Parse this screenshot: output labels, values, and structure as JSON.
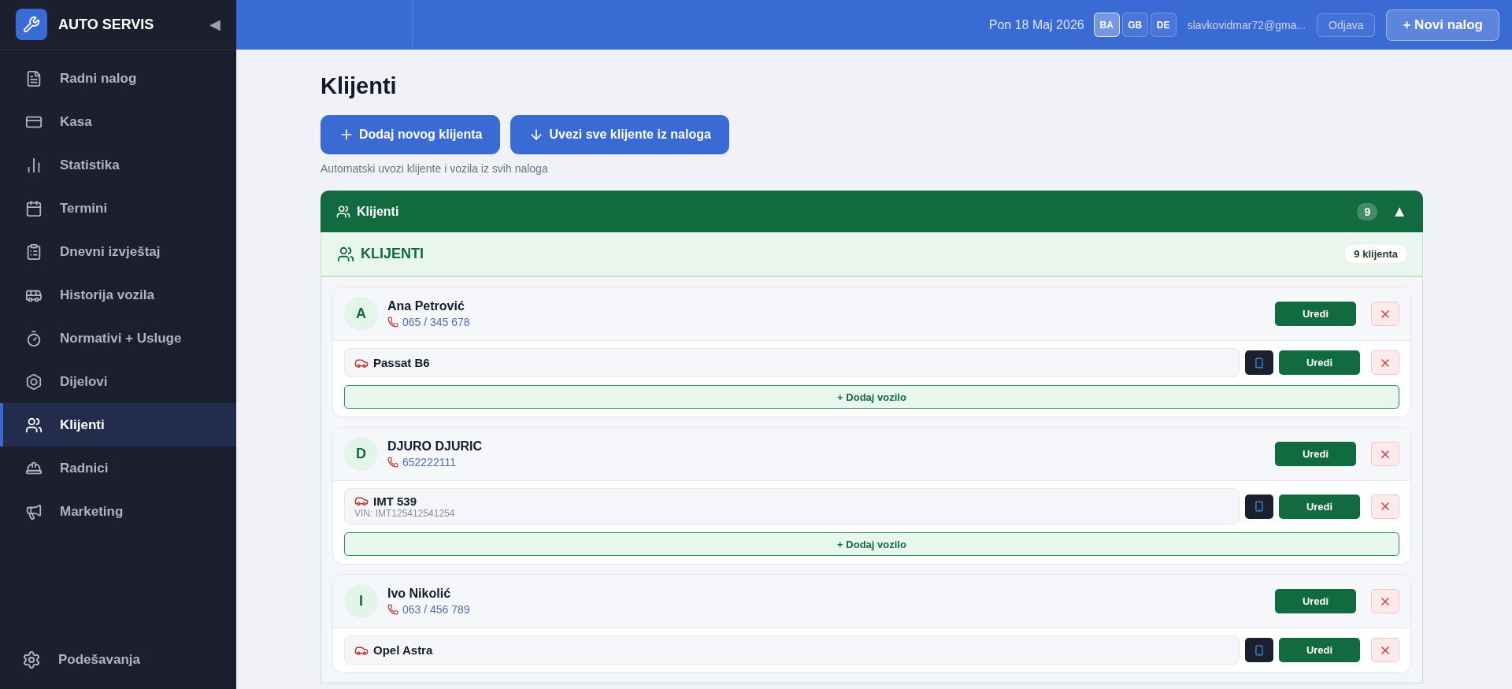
{
  "sidebar": {
    "title": "AUTO SERVIS",
    "collapse": "◀",
    "items": [
      {
        "label": "Radni nalog",
        "selected": false
      },
      {
        "label": "Kasa",
        "selected": false
      },
      {
        "label": "Statistika",
        "selected": false
      },
      {
        "label": "Termini",
        "selected": false
      },
      {
        "label": "Dnevni izvještaj",
        "selected": false
      },
      {
        "label": "Historija vozila",
        "selected": false
      },
      {
        "label": "Normativi + Usluge",
        "selected": false
      },
      {
        "label": "Dijelovi",
        "selected": false
      },
      {
        "label": "Klijenti",
        "selected": true
      },
      {
        "label": "Radnici",
        "selected": false
      },
      {
        "label": "Marketing",
        "selected": false
      }
    ],
    "footer": "Podešavanja"
  },
  "topbar": {
    "date": "Pon 18 Maj 2026",
    "languages": [
      {
        "label": "BA",
        "selected": true
      },
      {
        "label": "GB",
        "selected": false
      },
      {
        "label": "DE",
        "selected": false
      }
    ],
    "user": "slavkovidmar72@gma...",
    "logout": "Odjava",
    "new_order": "+ Novi nalog"
  },
  "page": {
    "title": "Klijenti",
    "actions": [
      "Dodaj novog klijenta",
      "Uvezi sve klijente iz naloga"
    ],
    "hint": "Automatski uvozi klijente i vozila iz svih naloga"
  },
  "section": {
    "title": "Klijenti",
    "count": "9",
    "toggle": "▲",
    "expanded": true,
    "subtitle": "KLIJENTI",
    "subcount": "9 klijenta"
  },
  "clients": [
    {
      "initial": "A",
      "name": "Ana Petrović",
      "phone": "065 / 345 678",
      "edit": "Uredi",
      "vehicles": [
        {
          "name": "Passat B6",
          "edit": "Uredi"
        }
      ],
      "add_vehicle": "+ Dodaj vozilo"
    },
    {
      "initial": "D",
      "name": "DJURO DJURIC",
      "phone": "652222111",
      "edit": "Uredi",
      "vehicles": [
        {
          "name": "IMT 539",
          "vin": "VIN: IMT125412541254",
          "edit": "Uredi"
        }
      ],
      "add_vehicle": "+ Dodaj vozilo"
    },
    {
      "initial": "I",
      "name": "Ivo Nikolić",
      "phone": "063 / 456 789",
      "edit": "Uredi",
      "vehicles": [
        {
          "name": "Opel Astra",
          "edit": "Uredi"
        }
      ]
    }
  ]
}
